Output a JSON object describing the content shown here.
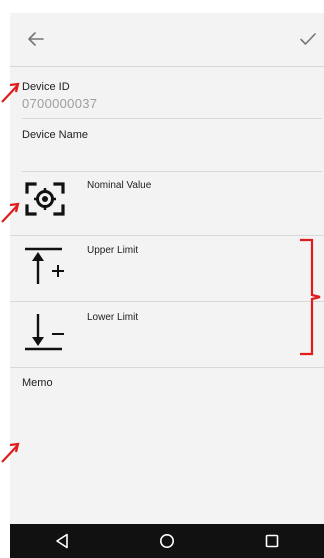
{
  "header": {
    "back_icon": "arrow-back-icon",
    "confirm_icon": "check-icon"
  },
  "form": {
    "device_id_label": "Device ID",
    "device_id_value": "0700000037",
    "device_name_label": "Device Name",
    "nominal_label": "Nominal Value",
    "upper_label": "Upper Limit",
    "lower_label": "Lower Limit",
    "memo_label": "Memo"
  },
  "navbar": {
    "back_icon": "nav-back-triangle-icon",
    "home_icon": "nav-home-circle-icon",
    "recents_icon": "nav-recents-square-icon"
  },
  "annotation_color": "#e01b1b"
}
